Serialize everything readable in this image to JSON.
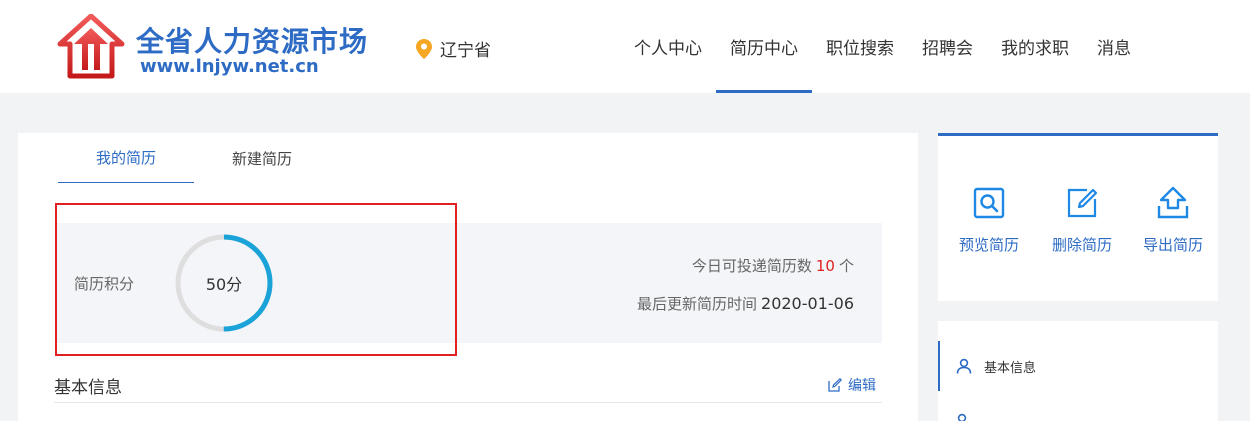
{
  "brand": {
    "title": "全省人力资源市场",
    "url": "www.lnjyw.net.cn",
    "color": "#2d6bc4"
  },
  "location": {
    "icon": "map-pin-icon",
    "label": "辽宁省"
  },
  "nav": {
    "items": [
      {
        "label": "个人中心"
      },
      {
        "label": "简历中心"
      },
      {
        "label": "职位搜索"
      },
      {
        "label": "招聘会"
      },
      {
        "label": "我的求职"
      },
      {
        "label": "消息"
      }
    ],
    "active": "简历中心"
  },
  "resume": {
    "tabs": [
      {
        "label": "我的简历"
      },
      {
        "label": "新建简历"
      }
    ],
    "score_label": "简历积分",
    "score_value": 50,
    "score_text": "50分",
    "deliver_prefix": "今日可投递简历数",
    "deliver_count": "10",
    "deliver_suffix": "个",
    "update_prefix": "最后更新简历时间",
    "update_date": "2020-01-06"
  },
  "basic_info": {
    "title": "基本信息",
    "edit_label": "编辑"
  },
  "actions": [
    {
      "label": "预览简历",
      "icon": "preview-icon"
    },
    {
      "label": "删除简历",
      "icon": "edit-square-icon"
    },
    {
      "label": "导出简历",
      "icon": "export-icon"
    }
  ],
  "side_menu": {
    "items": [
      {
        "label": "基本信息",
        "icon": "user-icon"
      }
    ]
  },
  "colors": {
    "accent": "#2d6bc4",
    "ring": "#1aa3d9",
    "highlight": "#e02020"
  }
}
